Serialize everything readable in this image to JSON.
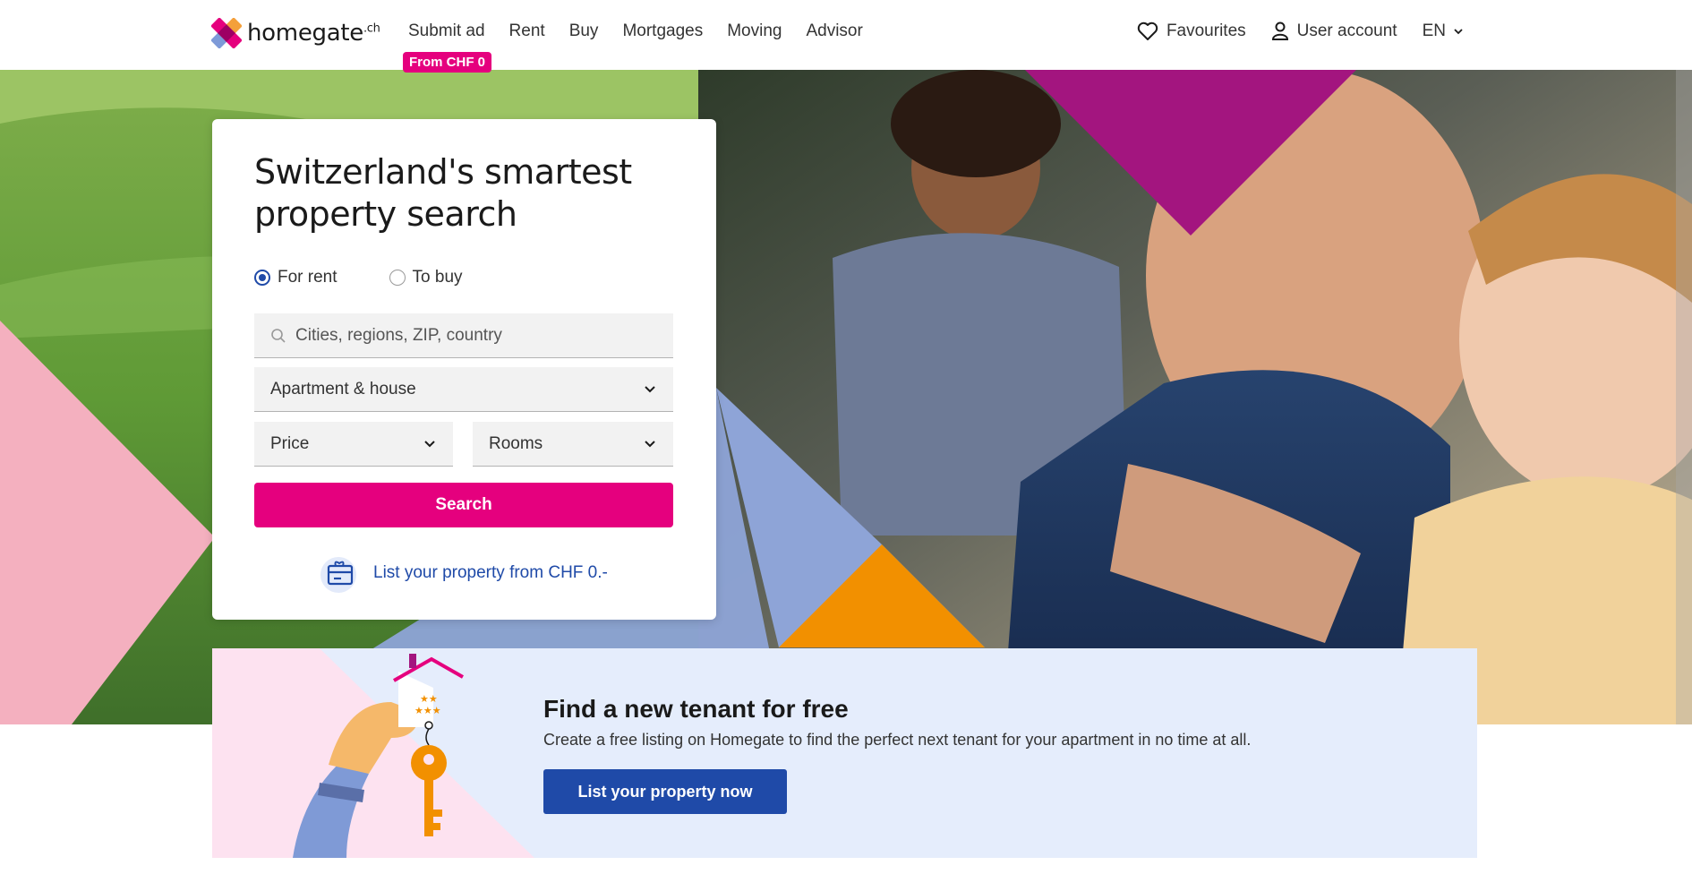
{
  "header": {
    "logo_text": "homegate",
    "logo_suffix": ".ch",
    "nav": [
      "Submit ad",
      "Rent",
      "Buy",
      "Mortgages",
      "Moving",
      "Advisor"
    ],
    "badge": "From CHF 0",
    "favourites": "Favourites",
    "user_account": "User account",
    "language": "EN"
  },
  "search": {
    "title": "Switzerland's smartest property search",
    "radio_rent": "For rent",
    "radio_buy": "To buy",
    "selected": "For rent",
    "location_placeholder": "Cities, regions, ZIP, country",
    "type_value": "Apartment & house",
    "price_label": "Price",
    "rooms_label": "Rooms",
    "search_button": "Search",
    "list_link": "List your property from CHF 0.-"
  },
  "promo": {
    "title": "Find a new tenant for free",
    "text": "Create a free listing on Homegate to find the perfect next tenant for your apartment in no time at all.",
    "button": "List your property now"
  },
  "colors": {
    "brand_pink": "#e5007e",
    "brand_blue": "#1f4aa8",
    "promo_bg": "#e5edfc"
  }
}
